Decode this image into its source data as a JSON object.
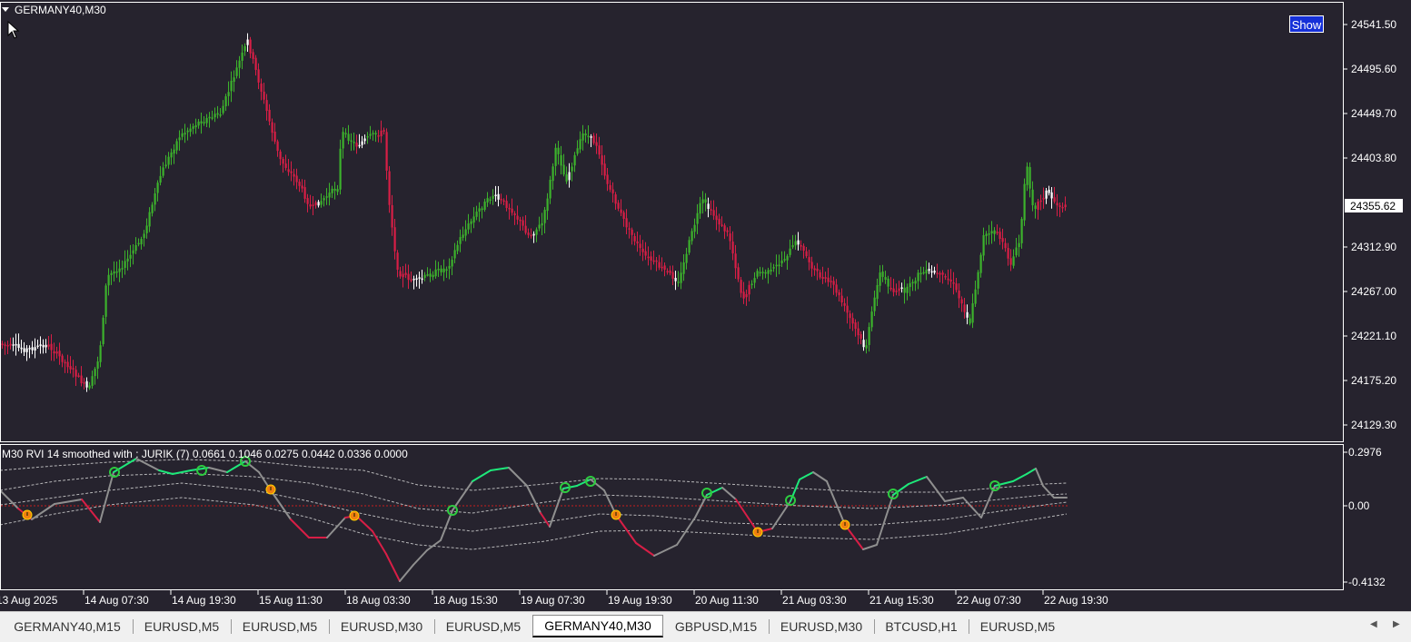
{
  "chart": {
    "symbol_title": "GERMANY40,M30",
    "show_button_label": "Show",
    "current_price": "24355.62",
    "price_axis_labels": [
      "24541.50",
      "24495.60",
      "24449.70",
      "24403.80",
      "24312.90",
      "24267.00",
      "24221.10",
      "24175.20",
      "24129.30"
    ],
    "time_axis_labels": [
      "13 Aug 2025",
      "14 Aug 07:30",
      "14 Aug 19:30",
      "15 Aug 11:30",
      "18 Aug 03:30",
      "18 Aug 15:30",
      "19 Aug 07:30",
      "19 Aug 19:30",
      "20 Aug 11:30",
      "21 Aug 03:30",
      "21 Aug 15:30",
      "22 Aug 07:30",
      "22 Aug 19:30"
    ],
    "colors": {
      "background": "#26232e",
      "bull": "#3cb22c",
      "bear": "#d81e46",
      "neutral": "#ffffff",
      "axis_text": "#ffffff"
    }
  },
  "indicator": {
    "title": "M30 RVI 14 smoothed with : JURIK (7) 0.0661 0.1046 0.0275 0.0442 0.0336 0.0000",
    "axis_labels": [
      "0.2976",
      "0.00",
      "-0.4132"
    ],
    "colors": {
      "up": "#1ee87a",
      "down": "#d81e46",
      "neutral": "#8f8f8f",
      "bands": "#d0d0d0",
      "zero_line": "#c81e1e",
      "buy_marker": "#2ecc40",
      "sell_marker": "#f08010"
    }
  },
  "tabs": [
    {
      "label": "GERMANY40,M15",
      "active": false
    },
    {
      "label": "EURUSD,M5",
      "active": false
    },
    {
      "label": "EURUSD,M5",
      "active": false
    },
    {
      "label": "EURUSD,M30",
      "active": false
    },
    {
      "label": "EURUSD,M5",
      "active": false
    },
    {
      "label": "GERMANY40,M30",
      "active": true
    },
    {
      "label": "GBPUSD,M15",
      "active": false
    },
    {
      "label": "EURUSD,M30",
      "active": false
    },
    {
      "label": "BTCUSD,H1",
      "active": false
    },
    {
      "label": "EURUSD,M5",
      "active": false
    }
  ],
  "icons": {
    "scroll_left": "triangle-left-icon",
    "scroll_right": "triangle-right-icon",
    "title_dropdown": "triangle-down-icon",
    "cursor": "mouse-pointer-icon"
  }
}
